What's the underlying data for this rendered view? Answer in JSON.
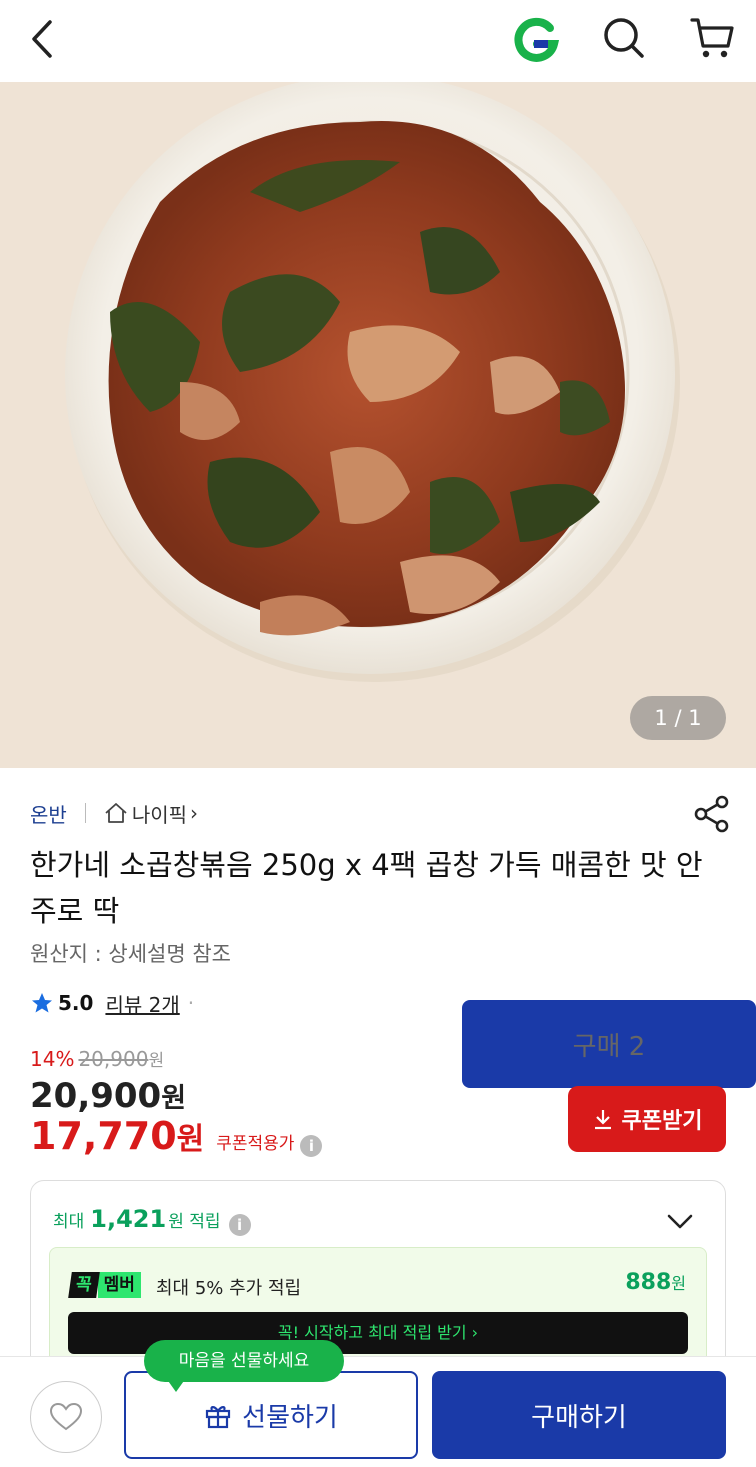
{
  "header": {
    "back_icon": "chevron-left-icon",
    "logo_icon": "gmarket-g-logo",
    "search_icon": "search-icon",
    "cart_icon": "cart-icon",
    "logo_color": "#19b24a"
  },
  "gallery": {
    "counter": "1 / 1"
  },
  "product": {
    "seller": "온반",
    "pick_label": "나이픽",
    "pick_chevron": "›",
    "title": "한가네 소곱창볶음 250g x 4팩 곱창 가득 매콤한 맛 안주로 딱",
    "origin": "원산지 : 상세설명 참조",
    "rating": "5.0",
    "review": "리뷰 2개",
    "dot": "·",
    "purchases": "구매 2"
  },
  "price": {
    "discount": "14%",
    "original": "20,900",
    "original_unit": "원",
    "sale": "20,900",
    "sale_unit": "원",
    "coupon_price": "17,770",
    "coupon_unit": "원",
    "coupon_label": "쿠폰적용가",
    "info_glyph": "i",
    "coupon_button": "쿠폰받기",
    "accent_color": "#d81a1a"
  },
  "benefit": {
    "max_prefix": "최대",
    "max_points": "1,421",
    "max_suffix": "원 적립",
    "info_glyph": "i",
    "member_badge_k": "꼭",
    "member_badge_m": "멤버",
    "member_text": "최대 5% 추가 적립",
    "member_points": "888",
    "member_points_unit": "원",
    "member_cta": "꼭! 시작하고 최대 적립 받기  ›",
    "accent_color": "#0aa05c"
  },
  "bottom": {
    "tooltip": "마음을 선물하세요",
    "gift_button": "선물하기",
    "buy_button": "구매하기",
    "brand_color": "#1a3aa8"
  }
}
